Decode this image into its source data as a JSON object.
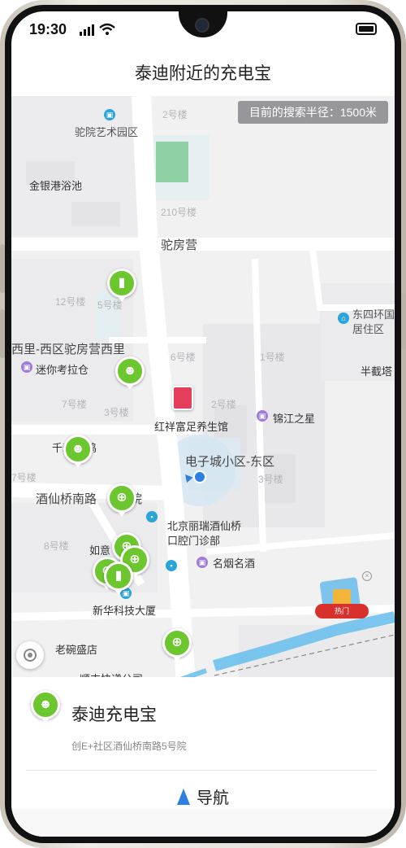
{
  "status_bar": {
    "time": "19:30"
  },
  "header": {
    "title": "泰迪附近的充电宝"
  },
  "map": {
    "radius_label": "目前的搜索半径：1500米",
    "labels": {
      "tuoyuan_art": "驼院艺术园区",
      "bldg2": "2号楼",
      "jinyin_bath": "金银港浴池",
      "bldg210": "210号楼",
      "tuofang": "驼房营",
      "bldg12": "12号楼",
      "bldg5": "5号楼",
      "dongsi": "东四环国",
      "juzhuqu": "居住区",
      "xili": "西里-西区驼房营西里",
      "bldg6": "6号楼",
      "bldg1": "1号楼",
      "minicola": "迷你考拉仓",
      "banjie": "半截塔",
      "bldg7": "7号楼",
      "bldg3": "3号楼",
      "bldg2b": "2号楼",
      "hongxiang": "红祥富足养生馆",
      "jinjiang": "锦江之星",
      "qianhe": "千禾",
      "ji": "鸡",
      "dianzicheng": "电子城小区-东区",
      "bldg7b": "7号楼",
      "bldg3b": "3号楼",
      "jiuxianqiao_road": "酒仙桥南路",
      "yuan": "院",
      "beijing_lirui1": "北京丽瑞酒仙桥",
      "beijing_lirui2": "口腔门诊部",
      "bldg8": "8号楼",
      "ruyi": "如意",
      "mingyan": "名烟名酒",
      "xinhua": "新华科技大厦",
      "laowan": "老碗盛店",
      "shunfeng": "顺丰快递公司",
      "hot_badge": "热门"
    }
  },
  "card": {
    "title": "泰迪充电宝",
    "address": "创E+社区酒仙桥南路5号院",
    "nav_label": "导航"
  },
  "colors": {
    "pin_green": "#6cc62e",
    "nav_blue": "#2f7fe0",
    "route_blue": "#6ec1ee"
  }
}
